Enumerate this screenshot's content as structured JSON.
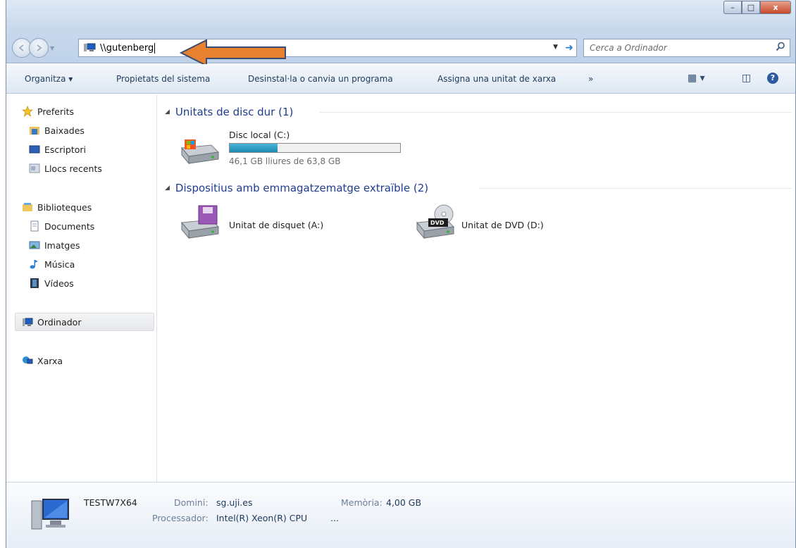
{
  "window": {
    "controls": {
      "minimize": "–",
      "maximize": "□",
      "close": "x"
    }
  },
  "address_bar": {
    "value": "\\\\gutenberg",
    "dropdown_icon": "chevron-down-icon",
    "go_icon": "go-arrow-icon"
  },
  "search": {
    "placeholder": "Cerca a Ordinador",
    "icon": "search-icon"
  },
  "toolbar": {
    "organize": "Organitza ▾",
    "system_properties": "Propietats del sistema",
    "uninstall": "Desinstal·la o canvia un programa",
    "map_drive": "Assigna una unitat de xarxa",
    "more": "»",
    "view_icon": "▦ ▾",
    "preview_icon": "◫",
    "help_icon": "?"
  },
  "sidebar": {
    "favorites": "Preferits",
    "favorites_items": [
      "Baixades",
      "Escriptori",
      "Llocs recents"
    ],
    "libraries": "Biblioteques",
    "libraries_items": [
      "Documents",
      "Imatges",
      "Música",
      "Vídeos"
    ],
    "computer": "Ordinador",
    "network": "Xarxa"
  },
  "content": {
    "hard_disks_header": "Unitats de disc dur (1)",
    "removable_header": "Dispositius amb emmagatzematge extraïble (2)",
    "local_disk": {
      "name": "Disc local (C:)",
      "free_text": "46,1 GB lliures de 63,8 GB",
      "used_fraction": 0.28
    },
    "floppy": "Unitat de disquet (A:)",
    "dvd": "Unitat de DVD (D:)",
    "dvd_badge": "DVD"
  },
  "details": {
    "computer_name": "TESTW7X64",
    "domain_label": "Domini:",
    "domain_value": "sg.uji.es",
    "memory_label": "Memòria:",
    "memory_value": "4,00 GB",
    "processor_label": "Processador:",
    "processor_value": "Intel(R) Xeon(R) CPU",
    "processor_more": "..."
  },
  "colors": {
    "annotation_arrow": "#e8812f",
    "group_header": "#1e3d8f",
    "progress_fill": "#2a9ec5"
  }
}
